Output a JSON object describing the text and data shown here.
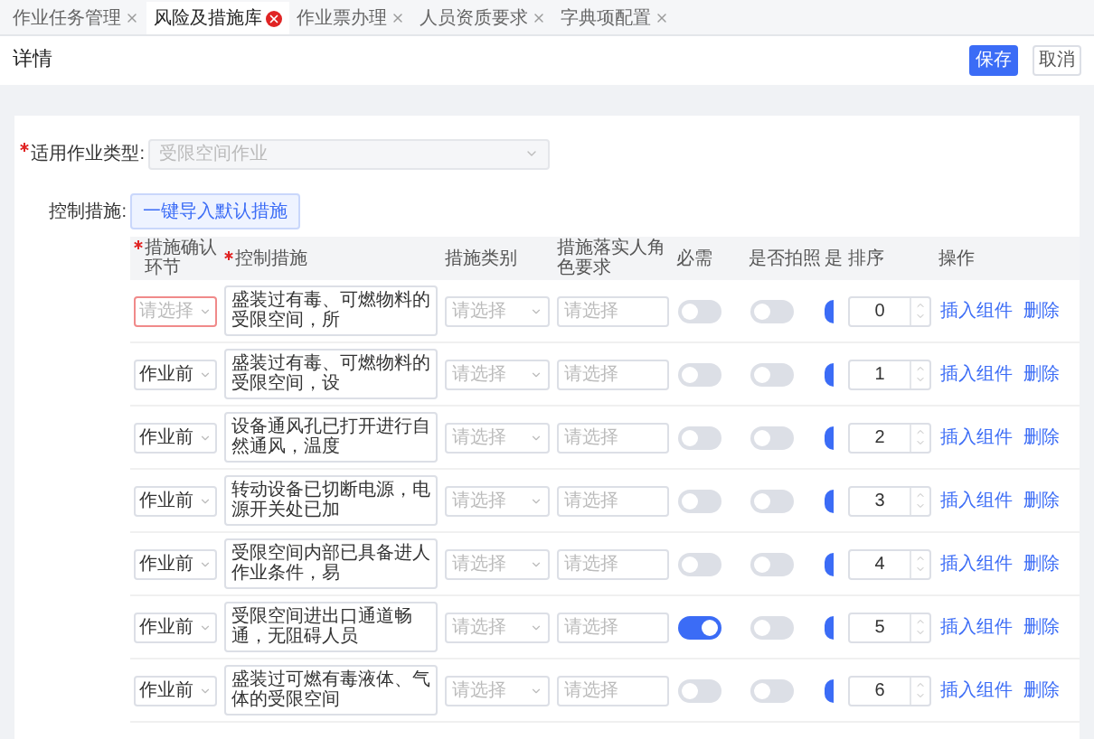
{
  "tabs": [
    {
      "label": "作业任务管理",
      "selected": false
    },
    {
      "label": "风险及措施库",
      "selected": true
    },
    {
      "label": "作业票办理",
      "selected": false
    },
    {
      "label": "人员资质要求",
      "selected": false
    },
    {
      "label": "字典项配置",
      "selected": false
    }
  ],
  "page_title": "详情",
  "buttons": [
    {
      "label": "保存",
      "kind": "primary"
    },
    {
      "label": "取消",
      "kind": "default"
    }
  ],
  "work_type": {
    "label": "适用作业类型:",
    "required": true,
    "value": "受限空间作业",
    "disabled": true
  },
  "control_measures": {
    "label": "控制措施:",
    "import_button": "一键导入默认措施"
  },
  "table": {
    "columns": [
      {
        "label": "措施确认环节",
        "required": true
      },
      {
        "label": "控制措施",
        "required": true
      },
      {
        "label": "措施类别",
        "required": false
      },
      {
        "label": "措施落实人角色要求",
        "required": false
      },
      {
        "label": "必需",
        "required": false
      },
      {
        "label": "是否拍照",
        "required": false
      },
      {
        "label": "是",
        "required": false
      },
      {
        "label": "排序",
        "required": false
      },
      {
        "label": "操作",
        "required": false
      }
    ],
    "rows": [
      {
        "stage_placeholder": "请选择",
        "error": true,
        "measure": "盛装过有毒、可燃物料的受限空间，所",
        "category_placeholder": "请选择",
        "role_placeholder": "请选择",
        "required_on": false,
        "photo_on": false,
        "column_7_on": true,
        "order": "0",
        "actions": [
          "插入组件",
          "删除"
        ]
      },
      {
        "stage": "作业前",
        "error": false,
        "measure": "盛装过有毒、可燃物料的受限空间，设",
        "category_placeholder": "请选择",
        "role_placeholder": "请选择",
        "required_on": false,
        "photo_on": false,
        "column_7_on": true,
        "order": "1",
        "actions": [
          "插入组件",
          "删除"
        ]
      },
      {
        "stage": "作业前",
        "error": false,
        "measure": "设备通风孔已打开进行自然通风，温度",
        "category_placeholder": "请选择",
        "role_placeholder": "请选择",
        "required_on": false,
        "photo_on": false,
        "column_7_on": true,
        "order": "2",
        "actions": [
          "插入组件",
          "删除"
        ]
      },
      {
        "stage": "作业前",
        "error": false,
        "measure": "转动设备已切断电源，电源开关处已加",
        "category_placeholder": "请选择",
        "role_placeholder": "请选择",
        "required_on": false,
        "photo_on": false,
        "column_7_on": true,
        "order": "3",
        "actions": [
          "插入组件",
          "删除"
        ]
      },
      {
        "stage": "作业前",
        "error": false,
        "measure": "受限空间内部已具备进人作业条件，易",
        "category_placeholder": "请选择",
        "role_placeholder": "请选择",
        "required_on": false,
        "photo_on": false,
        "column_7_on": true,
        "order": "4",
        "actions": [
          "插入组件",
          "删除"
        ]
      },
      {
        "stage": "作业前",
        "error": false,
        "measure": "受限空间进出口通道畅通，无阻碍人员",
        "category_placeholder": "请选择",
        "role_placeholder": "请选择",
        "required_on": true,
        "photo_on": false,
        "column_7_on": true,
        "order": "5",
        "actions": [
          "插入组件",
          "删除"
        ]
      },
      {
        "stage": "作业前",
        "error": false,
        "measure": "盛装过可燃有毒液体、气体的受限空间",
        "category_placeholder": "请选择",
        "role_placeholder": "请选择",
        "required_on": false,
        "photo_on": false,
        "column_7_on": true,
        "order": "6",
        "actions": [
          "插入组件",
          "删除"
        ]
      }
    ]
  }
}
